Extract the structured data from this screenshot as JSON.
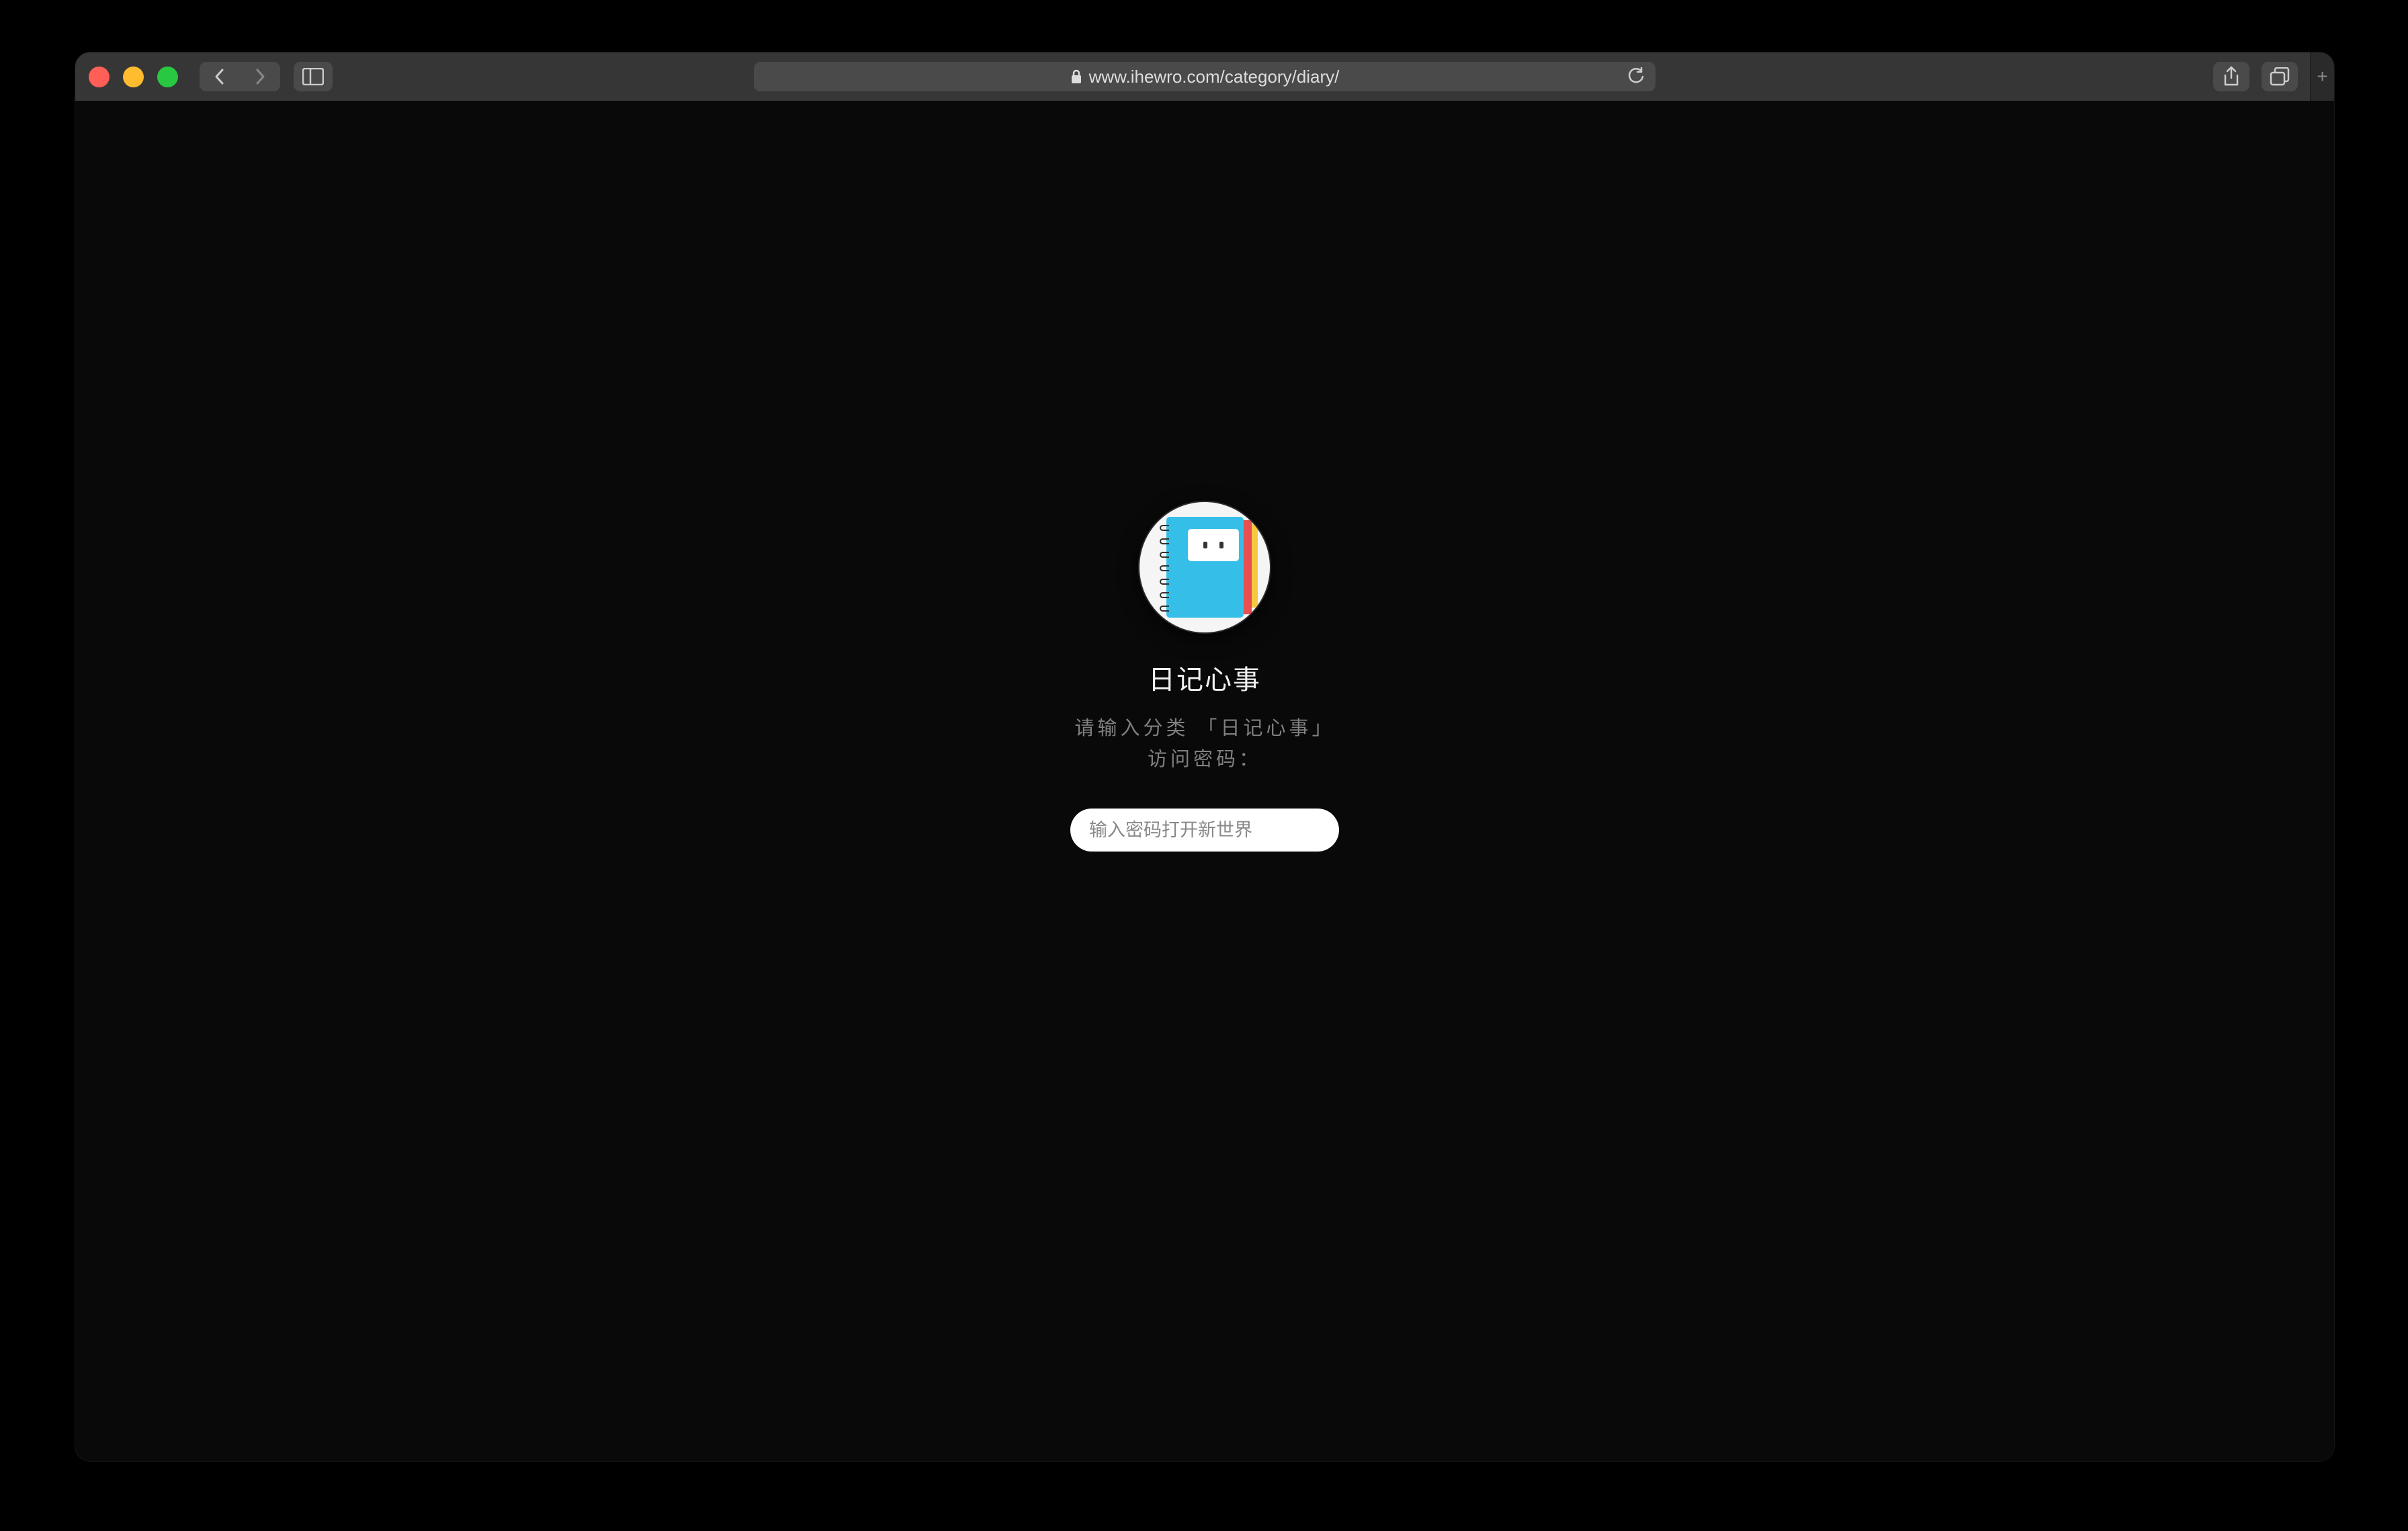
{
  "browser": {
    "url": "www.ihewro.com/category/diary/",
    "secure": true
  },
  "page": {
    "title": "日记心事",
    "subtitle": "请输入分类 「日记心事」 访问密码：",
    "password_placeholder": "输入密码打开新世界",
    "avatar_alt": "diary-notebook-icon"
  }
}
